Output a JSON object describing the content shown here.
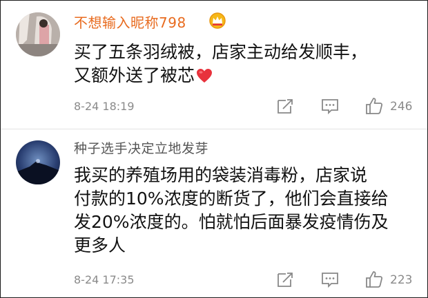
{
  "comments": [
    {
      "username": "不想输入昵称798",
      "badge_icon": "crown-badge-icon",
      "lines": [
        "买了五条羽绒被，店家主动给发顺丰，",
        "又额外送了被芯"
      ],
      "emoji": "heart-emoji-icon",
      "time": "8-24 18:19",
      "likes": "246"
    },
    {
      "username": "种子选手决定立地发芽",
      "lines": [
        "我买的养殖场用的袋装消毒粉，店家说",
        "付款的10%浓度的断货了，他们会直接给",
        "发20%浓度的。怕就怕后面暴发疫情伤及",
        "更多人"
      ],
      "time": "8-24 17:35",
      "likes": "223"
    }
  ],
  "colors": {
    "vip_username": "#e86b1f",
    "username": "#555555",
    "meta_text": "#8a8a8a",
    "heart": "#e8323c"
  }
}
